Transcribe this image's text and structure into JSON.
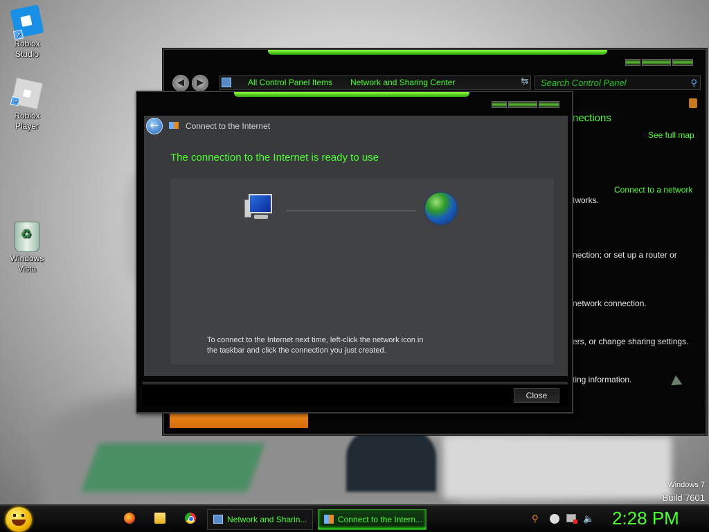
{
  "desktop": {
    "icons": [
      {
        "label_line1": "Roblox",
        "label_line2": "Studio"
      },
      {
        "label_line1": "Roblox",
        "label_line2": "Player"
      },
      {
        "label_line1": "Windows",
        "label_line2": "Vista"
      }
    ],
    "watermark": {
      "line1": "Windows 7",
      "line2": "Build 7601"
    }
  },
  "back_window": {
    "breadcrumbs": [
      "All Control Panel Items",
      "Network and Sharing Center"
    ],
    "search_placeholder": "Search Control Panel",
    "right_pane": {
      "heading": "nections",
      "see_full_map": "See full map",
      "connect_link": "Connect to a network",
      "line1": "tworks.",
      "line2": "nection; or set up a router or",
      "line3": "network connection.",
      "line4": "ers, or change sharing settings.",
      "line5": "ting information."
    }
  },
  "dialog": {
    "title": "Connect to the Internet",
    "heading": "The connection to the Internet is ready to use",
    "hint_line1": "To connect to the Internet next time, left-click the network icon in",
    "hint_line2": "the taskbar and click the connection you just created.",
    "close_label": "Close"
  },
  "taskbar": {
    "tasks": [
      {
        "label": "Network and Sharin..."
      },
      {
        "label": "Connect to the Intern..."
      }
    ],
    "clock": "2:28 PM"
  },
  "colors": {
    "accent": "#4cff2e",
    "window_bg": "#050505",
    "dialog_body": "#383a3e"
  }
}
